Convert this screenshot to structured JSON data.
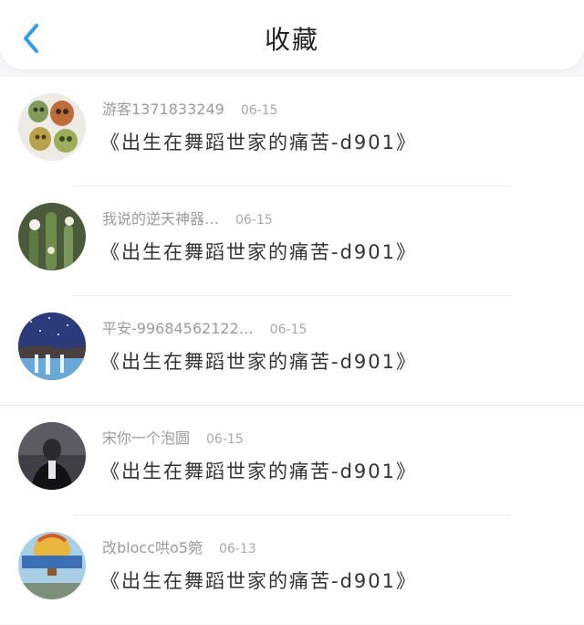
{
  "header": {
    "title": "收藏",
    "back_icon": "chevron-left-icon",
    "accent_color": "#2f9cf2"
  },
  "favorites": [
    {
      "user": "游客1371833249",
      "date": "06-15",
      "title": "《出生在舞蹈世家的痛苦-d901》"
    },
    {
      "user": "我说的逆天神器…",
      "date": "06-15",
      "title": "《出生在舞蹈世家的痛苦-d901》"
    },
    {
      "user": "平安-99684562122…",
      "date": "06-15",
      "title": "《出生在舞蹈世家的痛苦-d901》"
    },
    {
      "user": "宋你一个泡圆",
      "date": "06-15",
      "title": "《出生在舞蹈世家的痛苦-d901》"
    },
    {
      "user": "改blocc哄o5箢",
      "date": "06-13",
      "title": "《出生在舞蹈世家的痛苦-d901》"
    }
  ]
}
